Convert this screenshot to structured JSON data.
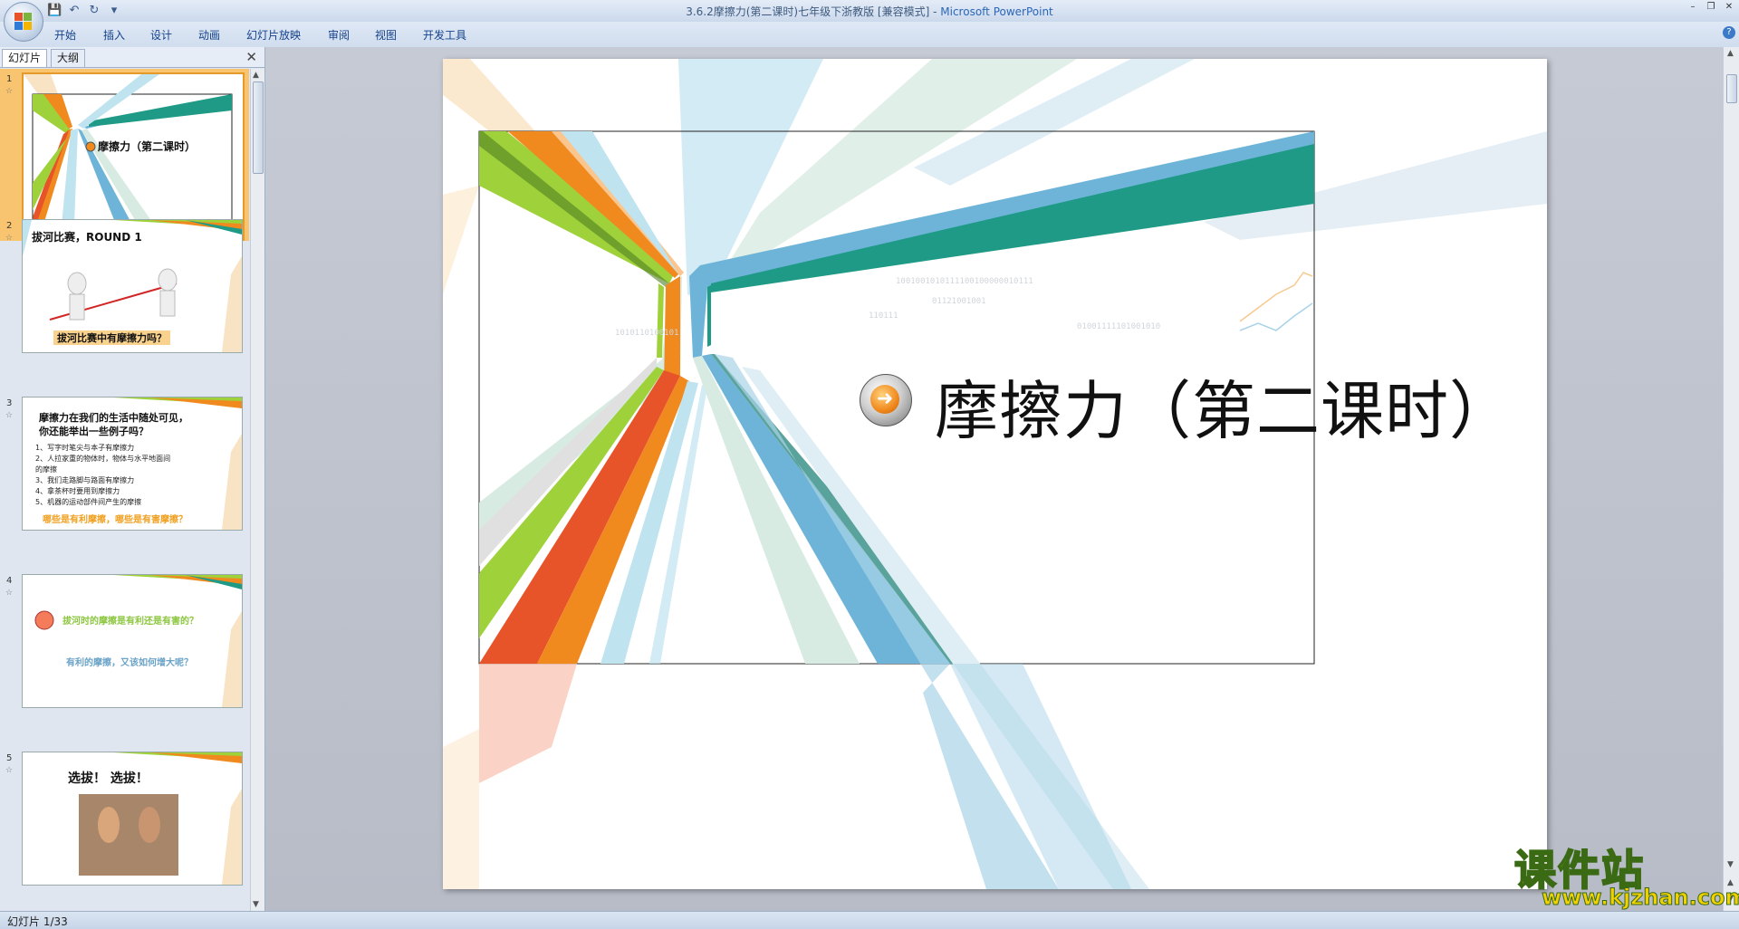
{
  "window": {
    "title": "3.6.2摩擦力(第二课时)七年级下浙教版 [兼容模式]",
    "app_name": "Microsoft PowerPoint",
    "separator": " - "
  },
  "quick_access": [
    "save-icon",
    "undo-icon",
    "redo-icon",
    "customize-icon"
  ],
  "ribbon": {
    "tabs": [
      "开始",
      "插入",
      "设计",
      "动画",
      "幻灯片放映",
      "审阅",
      "视图",
      "开发工具"
    ]
  },
  "panel": {
    "tabs": [
      "幻灯片",
      "大纲"
    ],
    "slides": [
      {
        "number": "1",
        "title": "摩擦力（第二课时）"
      },
      {
        "number": "2",
        "title": "拔河比赛，ROUND 1",
        "caption": "拔河比赛中有摩擦力吗？"
      },
      {
        "number": "3",
        "title": "摩擦力在我们的生活中随处可见，",
        "title2": "你还能举出一些例子吗？",
        "items": [
          "1、写字时笔尖与本子有摩擦力",
          "2、人拉家重的物体时，物体与水平地面间",
          "的摩擦",
          "3、我们走路脚与路面有摩擦力",
          "4、拿茶杯时要用到摩擦力",
          "5、机器的运动部件间产生的摩擦"
        ],
        "question": "哪些是有利摩擦，哪些是有害摩擦？"
      },
      {
        "number": "4",
        "line1": "拔河时的摩擦是有利还是有害的？",
        "line2": "有利的摩擦，又该如何增大呢？"
      },
      {
        "number": "5",
        "title": "选拔！ 选拔！"
      }
    ]
  },
  "slide": {
    "title": "摩擦力（第二课时）"
  },
  "status": {
    "text": "幻灯片 1/33"
  },
  "watermark": {
    "chinese": "课件站",
    "url": "www.kjzhan.com"
  }
}
